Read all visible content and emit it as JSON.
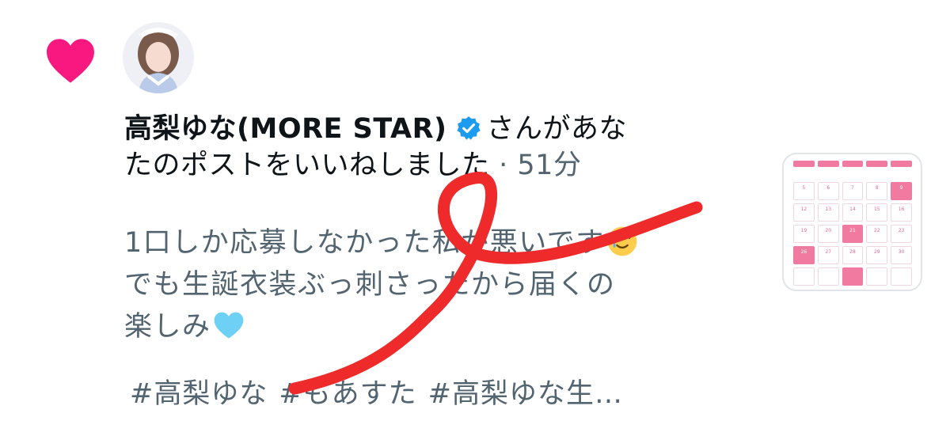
{
  "notification": {
    "type_icon": "heart-icon",
    "avatar_icon": "user-avatar",
    "user_name": "高梨ゆな(MORE STAR)",
    "verified_icon": "verified-badge-icon",
    "action_line1": "さんがあな",
    "action_line2": "たのポストをいいねしました",
    "separator": " · ",
    "time": "51分",
    "post_lines": [
      "1口しか応募しなかった私が悪いです",
      "でも生誕衣装ぶっ刺さったから届くの",
      "楽しみ"
    ],
    "emoji_line1": "smiling-face-with-tear-emoji",
    "emoji_line3": "light-blue-heart-emoji",
    "hashtags": [
      "#高梨ゆな",
      "#もあすた",
      "#高梨ゆな生…"
    ],
    "media_thumbnail": "calendar-image"
  },
  "colors": {
    "like_heart": "#f91880",
    "verified": "#1d9bf0",
    "primary_text": "#0f1419",
    "secondary_text": "#536471",
    "scribble": "#ee2a2a",
    "calendar_pink": "#f07aa0"
  },
  "calendar": {
    "cells": [
      "",
      "",
      "",
      "",
      "",
      "5",
      "6",
      "7",
      "8",
      "9",
      "12",
      "13",
      "14",
      "15",
      "16",
      "19",
      "20",
      "21",
      "22",
      "23",
      "26",
      "27",
      "28",
      "29",
      "30"
    ]
  }
}
